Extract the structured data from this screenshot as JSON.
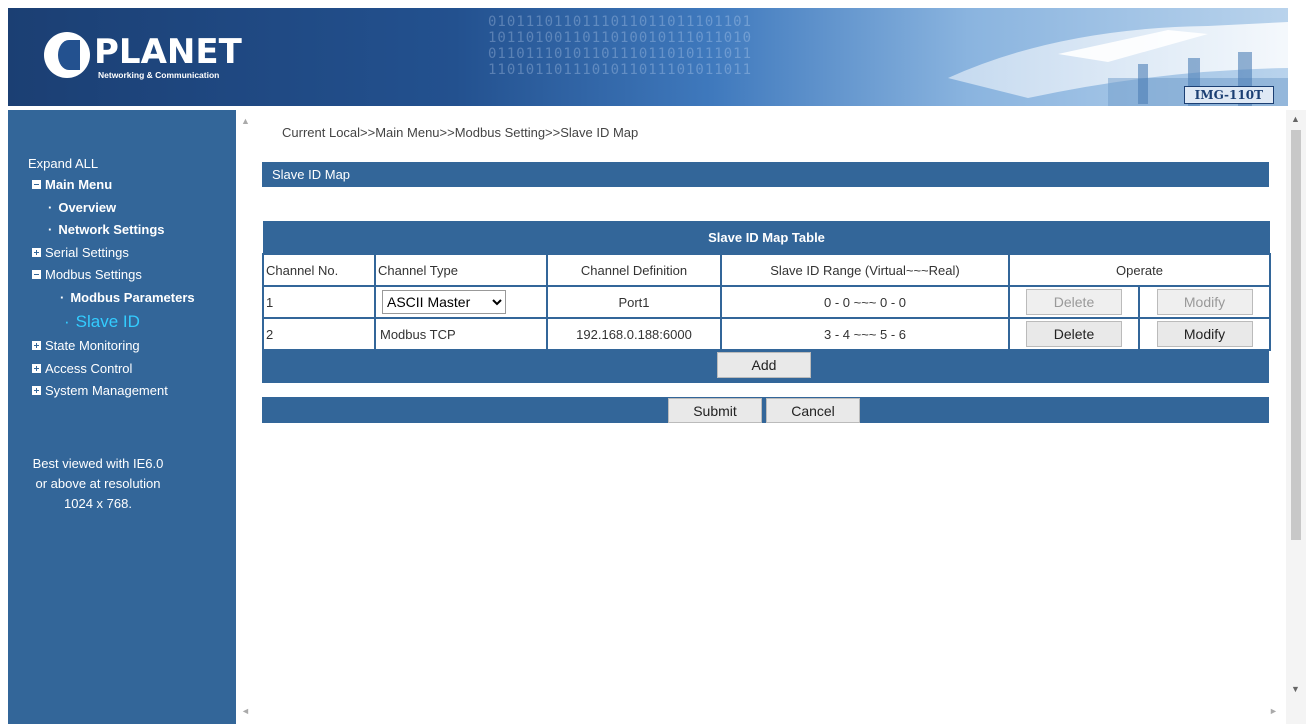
{
  "header": {
    "brand": "PLANET",
    "tagline": "Networking & Communication",
    "model": "IMG-110T",
    "binary_pattern": "0101110110111011011011101101\n1011010011011010010111011010\n0110111010110111011010111011\n1101011011101011011101011011"
  },
  "sidebar": {
    "expand_all": "Expand ALL",
    "items": [
      {
        "label": "Main Menu",
        "icon": "minus-box-icon"
      },
      {
        "label": "Overview",
        "icon": "bullet-icon"
      },
      {
        "label": "Network Settings",
        "icon": "bullet-icon"
      },
      {
        "label": "Serial Settings",
        "icon": "plus-box-icon"
      },
      {
        "label": "Modbus Settings",
        "icon": "minus-box-icon"
      },
      {
        "label": "Modbus Parameters",
        "icon": "bullet-icon"
      },
      {
        "label": "Slave ID",
        "icon": "bullet-icon"
      },
      {
        "label": "State Monitoring",
        "icon": "plus-box-icon"
      },
      {
        "label": "Access Control",
        "icon": "plus-box-icon"
      },
      {
        "label": "System Management",
        "icon": "plus-box-icon"
      }
    ],
    "best_viewed": [
      "Best viewed with IE6.0",
      "or above at resolution",
      "1024 x 768."
    ]
  },
  "main": {
    "breadcrumb": "Current Local>>Main Menu>>Modbus Setting>>Slave ID Map",
    "title": "Slave ID Map",
    "table": {
      "caption": "Slave ID Map Table",
      "columns": [
        "Channel No.",
        "Channel Type",
        "Channel Definition",
        "Slave ID Range (Virtual~~~Real)",
        "Operate"
      ],
      "rows": [
        {
          "no": "1",
          "type": "ASCII Master",
          "definition": "Port1",
          "range": "0 - 0 ~~~ 0 - 0",
          "delete": "Delete",
          "modify": "Modify"
        },
        {
          "no": "2",
          "type": "Modbus TCP",
          "definition": "192.168.0.188:6000",
          "range": "3 - 4 ~~~ 5 - 6",
          "delete": "Delete",
          "modify": "Modify"
        }
      ],
      "add_label": "Add"
    },
    "submit_label": "Submit",
    "cancel_label": "Cancel"
  },
  "colors": {
    "accent": "#336699",
    "active_item": "#33ccff"
  }
}
